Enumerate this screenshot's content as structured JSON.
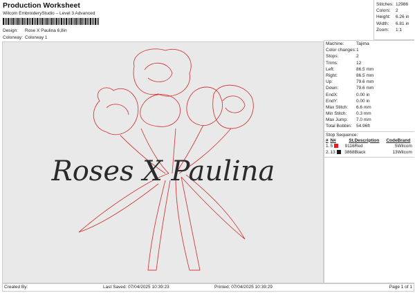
{
  "header": {
    "title": "Production Worksheet",
    "subtitle": "Wilcom EmbroideryStudio – Level 3 Advanced",
    "design_label": "Design:",
    "design_value": "Rose X Paulina 6,8in",
    "colorway_label": "Colorway:",
    "colorway_value": "Colorway 1"
  },
  "stats": [
    {
      "k": "Stitches:",
      "v": "12986"
    },
    {
      "k": "Colors:",
      "v": "2"
    },
    {
      "k": "Height:",
      "v": "6.26 in"
    },
    {
      "k": "Width:",
      "v": "6.81 in"
    },
    {
      "k": "Zoom:",
      "v": "1:1"
    }
  ],
  "info": [
    {
      "k": "Machine:",
      "v": "Tajima"
    },
    {
      "k": "Color changes:",
      "v": "1"
    },
    {
      "k": "Stops:",
      "v": "2"
    },
    {
      "k": "Trims:",
      "v": "12"
    },
    {
      "k": "Left:",
      "v": "86.5 mm"
    },
    {
      "k": "Right:",
      "v": "86.5 mm"
    },
    {
      "k": "Up:",
      "v": "79.6 mm"
    },
    {
      "k": "Down:",
      "v": "79.6 mm"
    },
    {
      "k": "EndX:",
      "v": "0.00 in"
    },
    {
      "k": "EndY:",
      "v": "0.00 in"
    },
    {
      "k": "Max Stitch:",
      "v": "6.6 mm"
    },
    {
      "k": "Min Stitch:",
      "v": "0.3 mm"
    },
    {
      "k": "Max Jump:",
      "v": "7.0 mm"
    },
    {
      "k": "Total Bobbin:",
      "v": "54.96ft"
    }
  ],
  "stop_sequence": {
    "label": "Stop Sequence:",
    "headers": [
      "#",
      "N#",
      "St.",
      "Description",
      "Code",
      "Brand"
    ],
    "rows": [
      {
        "n": "1.",
        "needle": "5",
        "color": "#e02020",
        "st": "9116",
        "desc": "Red",
        "code": "5",
        "brand": "Wilcom"
      },
      {
        "n": "2.",
        "needle": "13",
        "color": "#1a1a1a",
        "st": "3868",
        "desc": "Black",
        "code": "13",
        "brand": "Wilcom"
      }
    ]
  },
  "design": {
    "lettering": "Roses X Paulina",
    "outline_color": "#d23c3c",
    "text_color": "#2a2a2a"
  },
  "footer": {
    "created_by": "Created By:",
    "last_saved": "Last Saved: 07/04/2025 10:39:23",
    "printed": "Printed: 07/04/2025 10:39:29",
    "page": "Page 1 of 1"
  }
}
